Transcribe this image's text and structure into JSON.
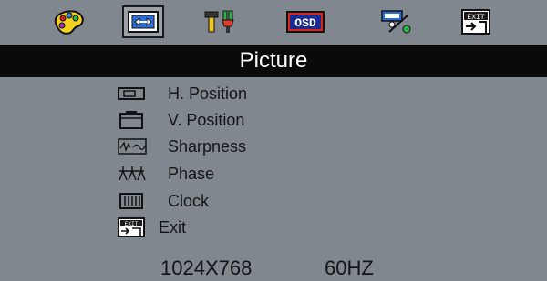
{
  "tabs": [
    {
      "icon": "palette-icon",
      "label": ""
    },
    {
      "icon": "picture-adjust-icon",
      "label": ""
    },
    {
      "icon": "tools-icon",
      "label": ""
    },
    {
      "icon": "osd-icon",
      "label": "OSD"
    },
    {
      "icon": "input-percent-icon",
      "label": ""
    },
    {
      "icon": "exit-icon",
      "label": "EXIT"
    }
  ],
  "title": "Picture",
  "menu_items": [
    {
      "icon": "h-position-icon",
      "label": "H. Position"
    },
    {
      "icon": "v-position-icon",
      "label": "V. Position"
    },
    {
      "icon": "sharpness-icon",
      "label": "Sharpness"
    },
    {
      "icon": "phase-icon",
      "label": "Phase"
    },
    {
      "icon": "clock-icon",
      "label": "Clock"
    },
    {
      "icon": "exit-icon",
      "label": "Exit"
    }
  ],
  "status": {
    "resolution": "1024X768",
    "refresh": "60HZ"
  },
  "colors": {
    "background": "#80878f",
    "titlebar": "#0a0a0a",
    "title_text": "#ffffff",
    "text": "#141414"
  }
}
